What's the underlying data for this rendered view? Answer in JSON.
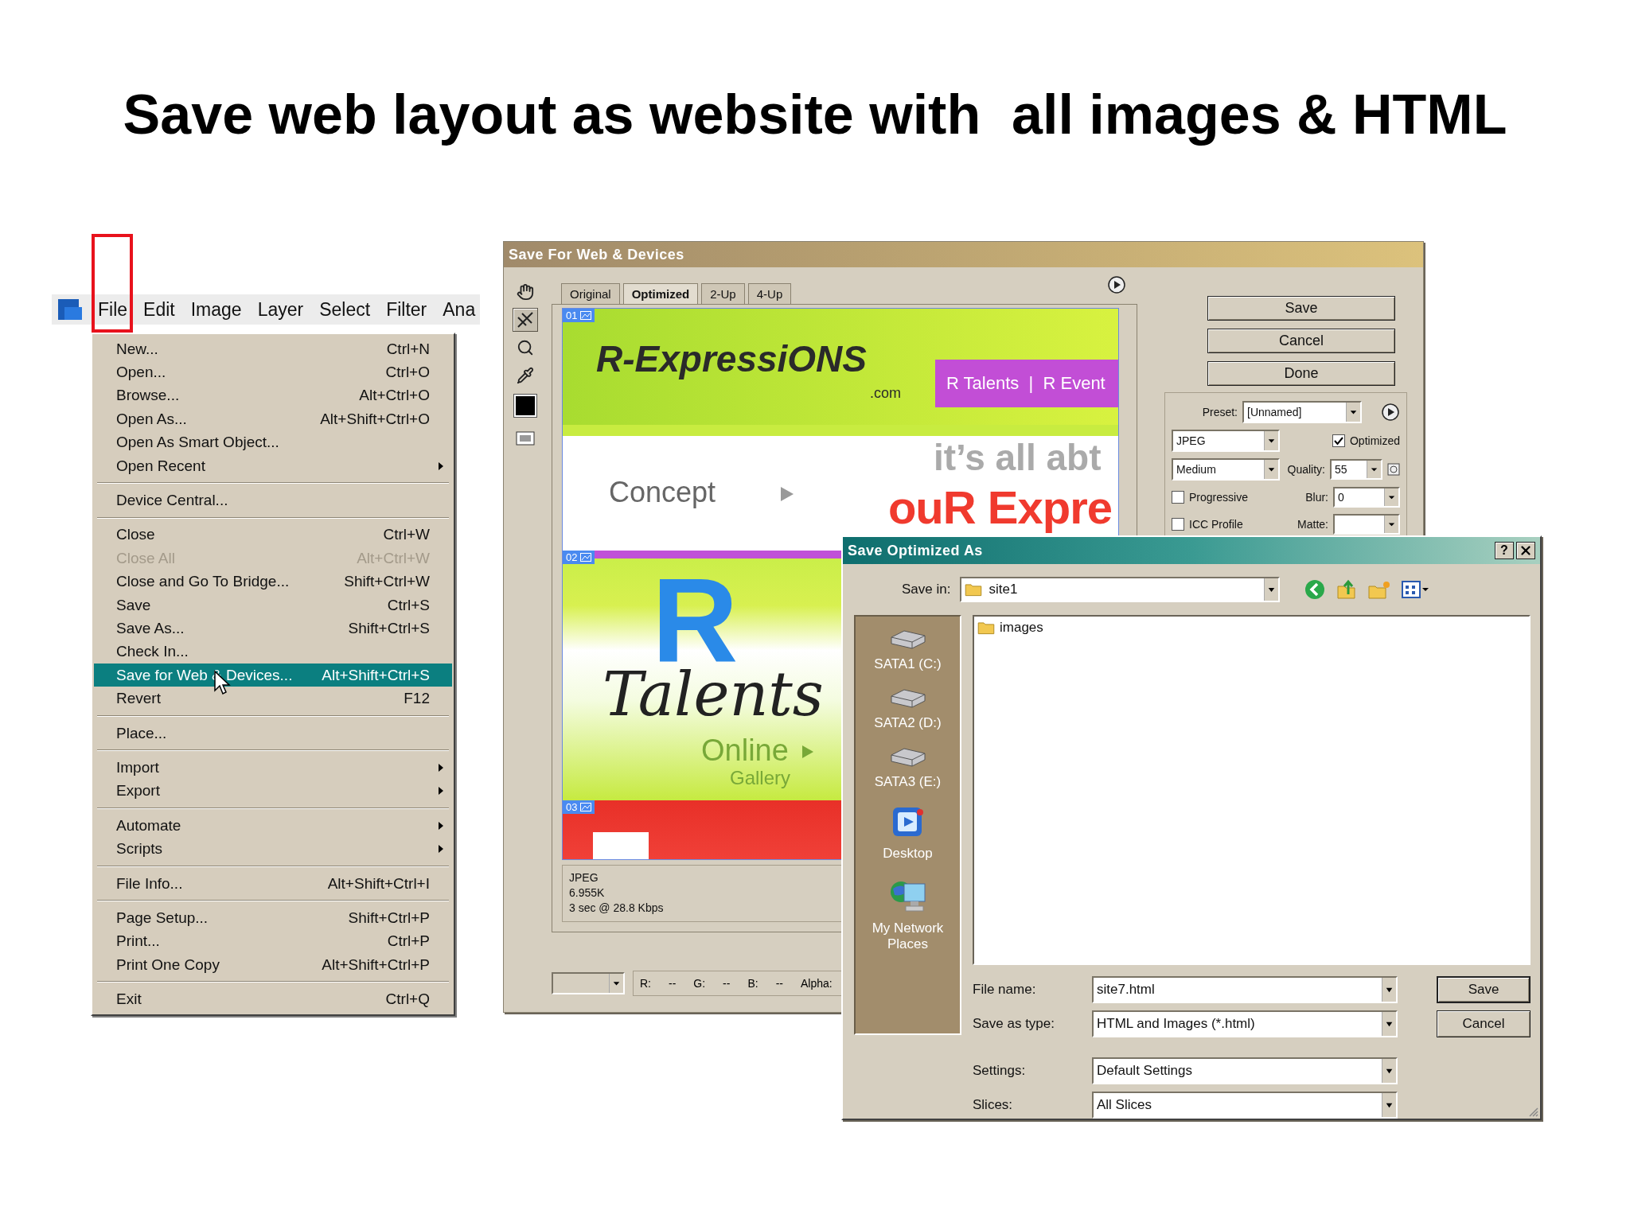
{
  "slide": {
    "title": "Save web layout as website with  all images & HTML"
  },
  "menubar": {
    "items": [
      {
        "label": "File",
        "highlighted": true
      },
      {
        "label": "Edit",
        "highlighted": false
      },
      {
        "label": "Image",
        "highlighted": false
      },
      {
        "label": "Layer",
        "highlighted": false
      },
      {
        "label": "Select",
        "highlighted": false
      },
      {
        "label": "Filter",
        "highlighted": false
      },
      {
        "label": "Ana",
        "highlighted": false
      }
    ]
  },
  "file_menu": {
    "sections": [
      [
        {
          "label": "New...",
          "shortcut": "Ctrl+N",
          "submenu": false,
          "disabled": false,
          "selected": false
        },
        {
          "label": "Open...",
          "shortcut": "Ctrl+O",
          "submenu": false,
          "disabled": false,
          "selected": false
        },
        {
          "label": "Browse...",
          "shortcut": "Alt+Ctrl+O",
          "submenu": false,
          "disabled": false,
          "selected": false
        },
        {
          "label": "Open As...",
          "shortcut": "Alt+Shift+Ctrl+O",
          "submenu": false,
          "disabled": false,
          "selected": false
        },
        {
          "label": "Open As Smart Object...",
          "submenu": false,
          "disabled": false,
          "selected": false
        },
        {
          "label": "Open Recent",
          "submenu": true,
          "disabled": false,
          "selected": false
        }
      ],
      [
        {
          "label": "Device Central...",
          "submenu": false,
          "disabled": false,
          "selected": false
        }
      ],
      [
        {
          "label": "Close",
          "shortcut": "Ctrl+W",
          "submenu": false,
          "disabled": false,
          "selected": false
        },
        {
          "label": "Close All",
          "shortcut": "Alt+Ctrl+W",
          "submenu": false,
          "disabled": true,
          "selected": false
        },
        {
          "label": "Close and Go To Bridge...",
          "shortcut": "Shift+Ctrl+W",
          "submenu": false,
          "disabled": false,
          "selected": false
        },
        {
          "label": "Save",
          "shortcut": "Ctrl+S",
          "submenu": false,
          "disabled": false,
          "selected": false
        },
        {
          "label": "Save As...",
          "shortcut": "Shift+Ctrl+S",
          "submenu": false,
          "disabled": false,
          "selected": false
        },
        {
          "label": "Check In...",
          "submenu": false,
          "disabled": false,
          "selected": false
        },
        {
          "label": "Save for Web & Devices...",
          "shortcut": "Alt+Shift+Ctrl+S",
          "submenu": false,
          "disabled": false,
          "selected": true
        },
        {
          "label": "Revert",
          "shortcut": "F12",
          "submenu": false,
          "disabled": false,
          "selected": false
        }
      ],
      [
        {
          "label": "Place...",
          "submenu": false,
          "disabled": false,
          "selected": false
        }
      ],
      [
        {
          "label": "Import",
          "submenu": true,
          "disabled": false,
          "selected": false
        },
        {
          "label": "Export",
          "submenu": true,
          "disabled": false,
          "selected": false
        }
      ],
      [
        {
          "label": "Automate",
          "submenu": true,
          "disabled": false,
          "selected": false
        },
        {
          "label": "Scripts",
          "submenu": true,
          "disabled": false,
          "selected": false
        }
      ],
      [
        {
          "label": "File Info...",
          "shortcut": "Alt+Shift+Ctrl+I",
          "submenu": false,
          "disabled": false,
          "selected": false
        }
      ],
      [
        {
          "label": "Page Setup...",
          "shortcut": "Shift+Ctrl+P",
          "submenu": false,
          "disabled": false,
          "selected": false
        },
        {
          "label": "Print...",
          "shortcut": "Ctrl+P",
          "submenu": false,
          "disabled": false,
          "selected": false
        },
        {
          "label": "Print One Copy",
          "shortcut": "Alt+Shift+Ctrl+P",
          "submenu": false,
          "disabled": false,
          "selected": false
        }
      ],
      [
        {
          "label": "Exit",
          "shortcut": "Ctrl+Q",
          "submenu": false,
          "disabled": false,
          "selected": false
        }
      ]
    ]
  },
  "save_for_web": {
    "title": "Save For Web & Devices",
    "tabs": [
      {
        "label": "Original",
        "selected": false
      },
      {
        "label": "Optimized",
        "selected": true
      },
      {
        "label": "2-Up",
        "selected": false
      },
      {
        "label": "4-Up",
        "selected": false
      }
    ],
    "tools": [
      {
        "kind": "hand",
        "selected": false
      },
      {
        "kind": "slice",
        "selected": true
      },
      {
        "kind": "zoom",
        "selected": false
      },
      {
        "kind": "eyedropper",
        "selected": false
      },
      {
        "kind": "swatch",
        "selected": false
      },
      {
        "kind": "toggle",
        "selected": false
      }
    ],
    "slices": [
      {
        "number": "01",
        "kind": "header",
        "logo": "R-ExpressiONS",
        "domain": ".com",
        "nav": "R Talents  |  R Event",
        "concept": "Concept",
        "tagline": "it’s all abt",
        "headline": "ouR Expre"
      },
      {
        "number": "02",
        "kind": "talents",
        "letter": "R",
        "word": "Talents",
        "online": "Online",
        "gallery": "Gallery"
      },
      {
        "number": "03",
        "kind": "banner"
      }
    ],
    "info": [
      "JPEG",
      "6.955K",
      "3 sec @ 28.8 Kbps"
    ],
    "buttons": [
      "Save",
      "Cancel",
      "Done"
    ],
    "settings": {
      "preset_label": "Preset:",
      "preset": "[Unnamed]",
      "format": "JPEG",
      "optimized": {
        "label": "Optimized",
        "checked": true
      },
      "quality_preset": "Medium",
      "quality_label": "Quality:",
      "quality": "55",
      "progressive": {
        "label": "Progressive",
        "checked": false
      },
      "blur_label": "Blur:",
      "blur": "0",
      "icc_profile": {
        "label": "ICC Profile",
        "checked": false
      },
      "matte_label": "Matte:"
    },
    "readouts": [
      {
        "label": "R:",
        "value": "--"
      },
      {
        "label": "G:",
        "value": "--"
      },
      {
        "label": "B:",
        "value": "--"
      },
      {
        "label": "Alpha:"
      }
    ]
  },
  "save_dialog": {
    "title": "Save Optimized As",
    "help": "?",
    "save_in_label": "Save in:",
    "save_in": "site1",
    "places": [
      {
        "label": "SATA1 (C:)",
        "kind": "drive"
      },
      {
        "label": "SATA2 (D:)",
        "kind": "drive"
      },
      {
        "label": "SATA3 (E:)",
        "kind": "drive"
      },
      {
        "label": "Desktop",
        "kind": "desktop"
      },
      {
        "label": "My Network Places",
        "kind": "network"
      }
    ],
    "files": [
      {
        "name": "images",
        "kind": "folder"
      }
    ],
    "fields": [
      {
        "label": "File name:",
        "value": "site7.html"
      },
      {
        "label": "Save as type:",
        "value": "HTML and Images (*.html)"
      },
      {
        "label": "Settings:",
        "value": "Default Settings"
      },
      {
        "label": "Slices:",
        "value": "All Slices"
      }
    ],
    "buttons": [
      "Save",
      "Cancel"
    ]
  }
}
